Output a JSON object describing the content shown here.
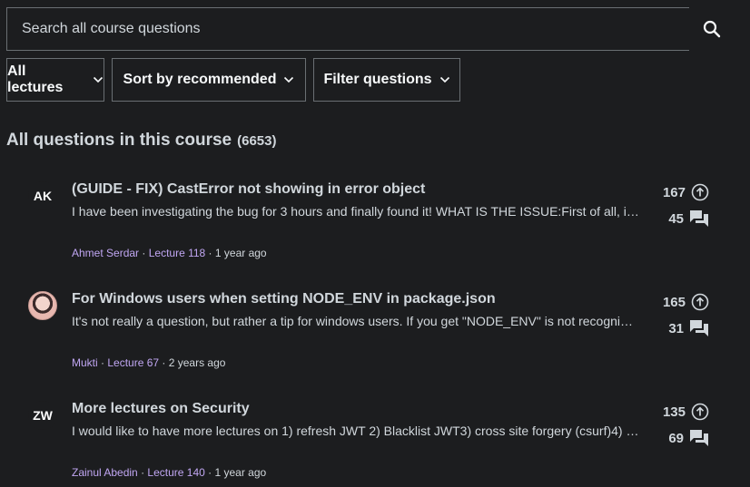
{
  "search": {
    "placeholder": "Search all course questions"
  },
  "filters": {
    "lectures_label": "All lectures",
    "sort_label": "Sort by recommended",
    "filter_label": "Filter questions"
  },
  "heading": {
    "title": "All questions in this course",
    "count": "(6653)"
  },
  "questions": [
    {
      "avatar_initials": "AK",
      "title": "(GUIDE - FIX) CastError not showing in error object",
      "body": "I have been investigating the bug for 3 hours and finally found it! WHAT IS THE ISSUE:First of all, in ...",
      "author": "Ahmet Serdar",
      "lecture": "Lecture 118",
      "time": "1 year ago",
      "upvotes": "167",
      "replies": "45"
    },
    {
      "avatar_initials": "",
      "title": "For Windows users when setting NODE_ENV in package.json",
      "body": "It's not really a question, but rather a tip for windows users. If you get \"NODE_ENV\" is not recognize...",
      "author": "Mukti",
      "lecture": "Lecture 67",
      "time": "2 years ago",
      "upvotes": "165",
      "replies": "31"
    },
    {
      "avatar_initials": "ZW",
      "title": "More lectures on Security",
      "body": "I would like to have more lectures on 1) refresh JWT 2) Blacklist JWT3) cross site forgery (csurf)4) wh...",
      "author": "Zainul Abedin",
      "lecture": "Lecture 140",
      "time": "1 year ago",
      "upvotes": "135",
      "replies": "69"
    }
  ],
  "colors": {
    "background": "#1c1d1f",
    "border": "#6a6f73",
    "text": "#d1d7dc",
    "link": "#c0a6f2"
  },
  "icons": {
    "search": "search-icon",
    "chevron": "chevron-down-icon",
    "upvote": "arrow-up-circle-icon",
    "replies": "chat-bubbles-icon"
  }
}
